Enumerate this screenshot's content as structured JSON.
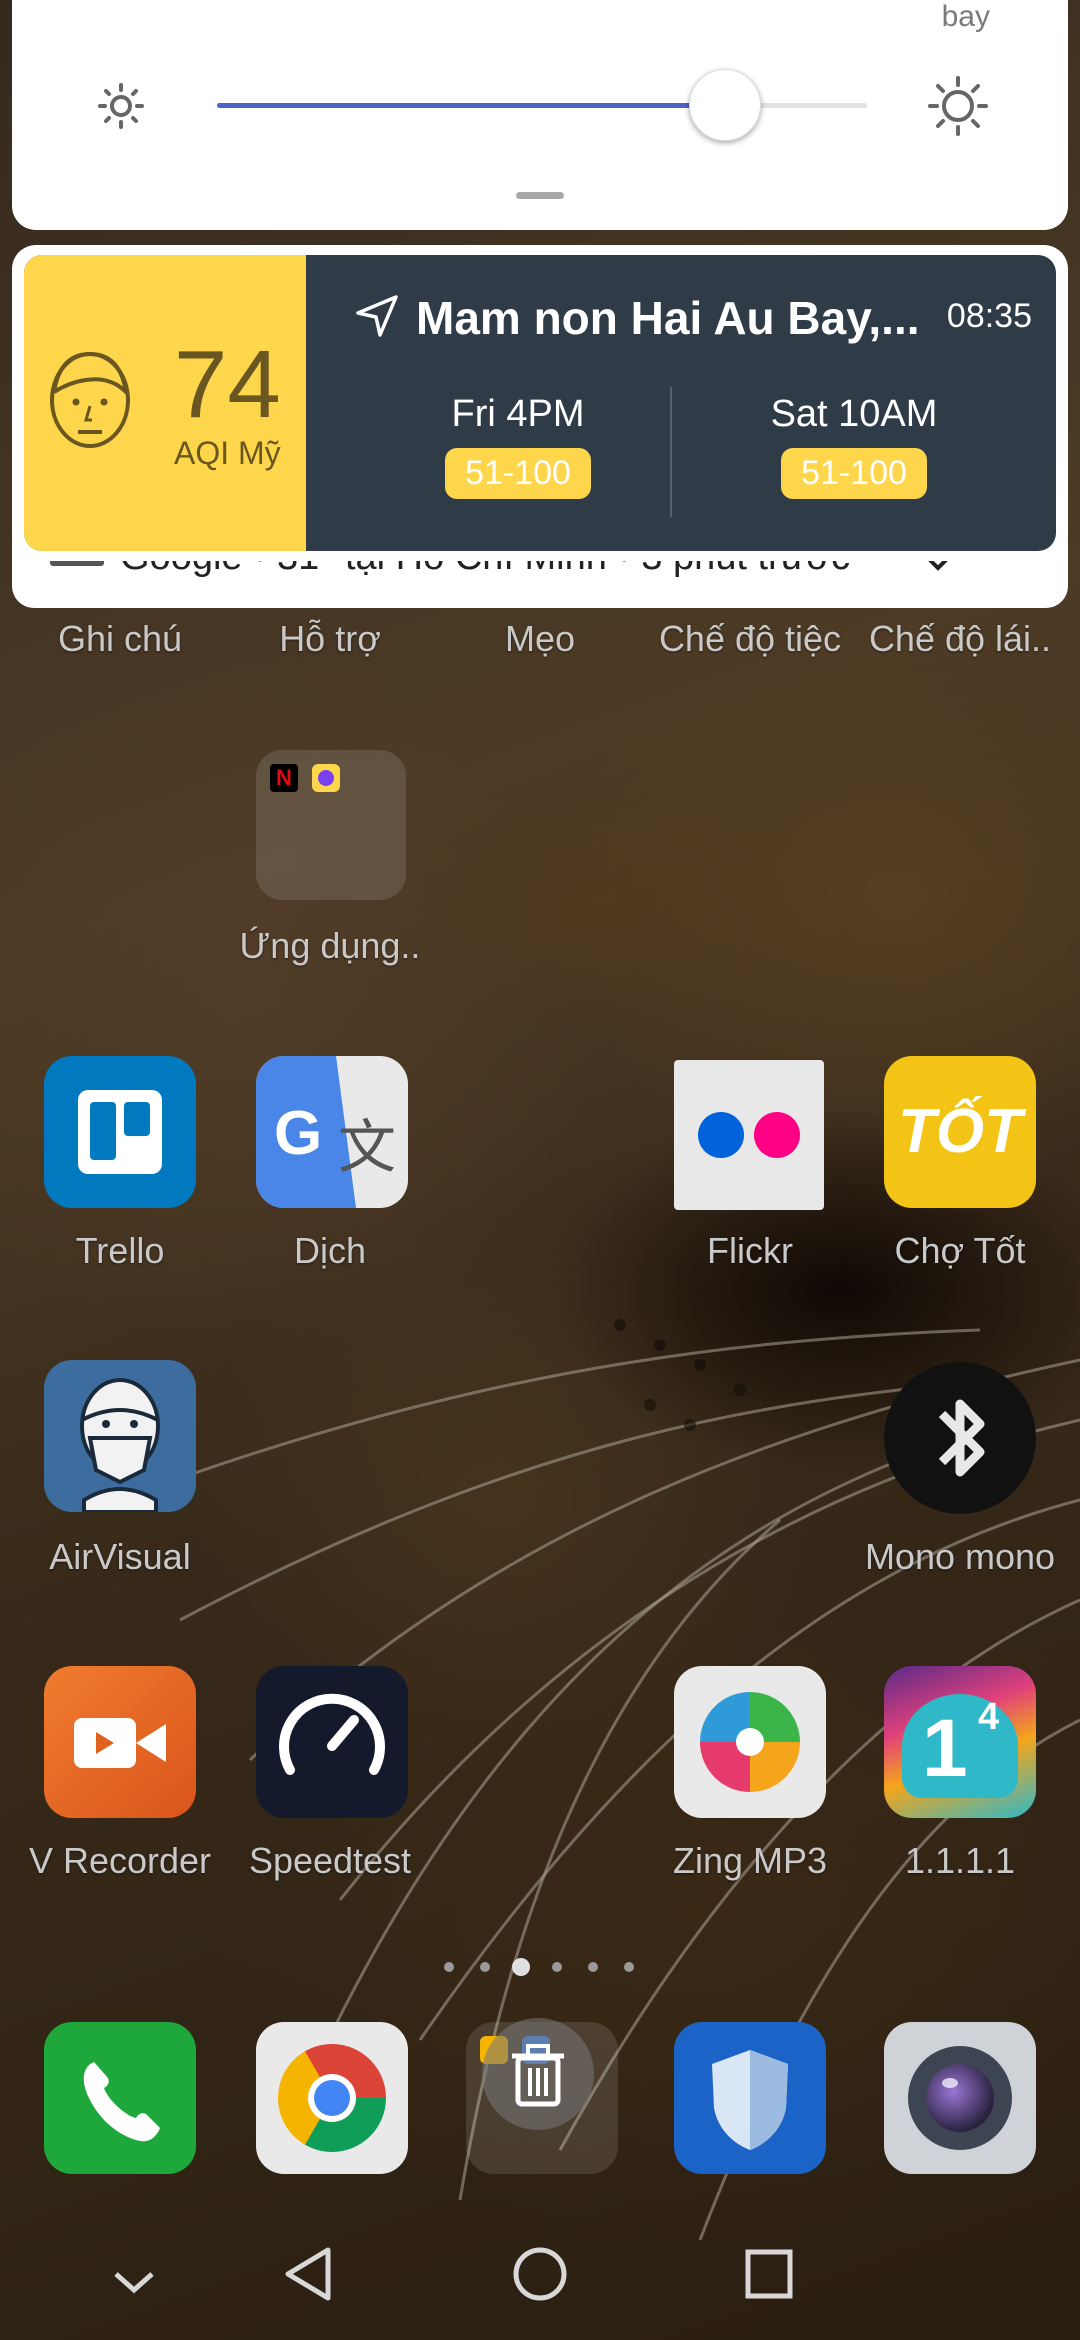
{
  "quick_settings": {
    "partial_label": "bay",
    "brightness_level": 0.78
  },
  "aqi_notification": {
    "aqi_value": "74",
    "aqi_unit": "AQI Mỹ",
    "location": "Mam non Hai Au Bay,...",
    "time": "08:35",
    "forecast": [
      {
        "label": "Fri 4PM",
        "range": "51-100"
      },
      {
        "label": "Sat 10AM",
        "range": "51-100"
      }
    ],
    "level_color": "#fdd64b",
    "panel_color": "#2f3b46"
  },
  "google_notification": {
    "text": "Google • 31° tại Hồ Chí Minh • 3 phút trước"
  },
  "home": {
    "row0_labels": [
      "Ghi chú",
      "Hỗ trợ",
      "Mẹo",
      "Chế độ tiệc",
      "Chế độ lái.."
    ],
    "folder_label": "Ứng dụng..",
    "apps": [
      {
        "label": "Trello",
        "icon": "trello-icon"
      },
      {
        "label": "Dịch",
        "icon": "translate-icon"
      },
      {
        "label": "Flickr",
        "icon": "flickr-icon"
      },
      {
        "label": "Chợ Tốt",
        "icon": "chotot-icon"
      },
      {
        "label": "AirVisual",
        "icon": "airvisual-icon"
      },
      {
        "label": "Mono mono",
        "icon": "bluetooth-icon"
      },
      {
        "label": "V Recorder",
        "icon": "video-recorder-icon"
      },
      {
        "label": "Speedtest",
        "icon": "speedometer-icon"
      },
      {
        "label": "Zing MP3",
        "icon": "zing-mp3-icon"
      },
      {
        "label": "1.1.1.1",
        "icon": "cloudflare-1111-icon"
      }
    ],
    "chotot_text": "TỐT",
    "one_text": "1",
    "four_text": "4"
  },
  "dock": [
    "phone-icon",
    "chrome-icon",
    "trash-icon",
    "shield-icon",
    "camera-icon"
  ],
  "page_indicator": {
    "count": 6,
    "active": 2
  }
}
